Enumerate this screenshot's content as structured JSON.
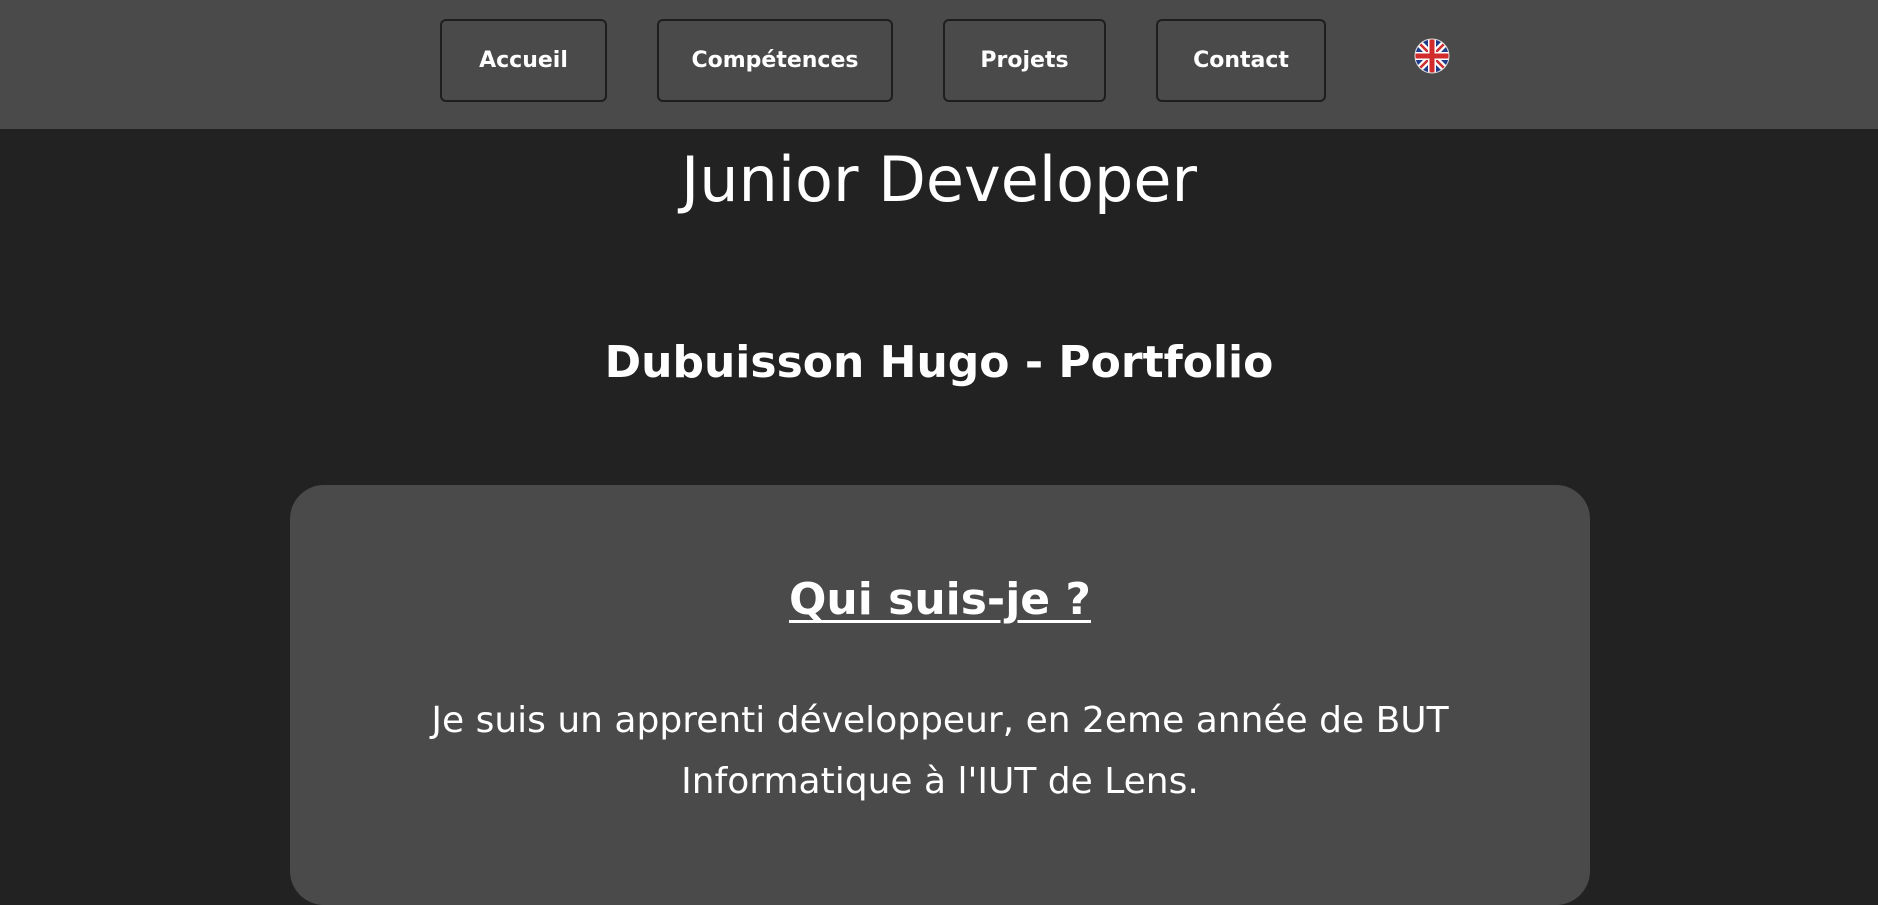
{
  "nav": {
    "items": [
      {
        "label": "Accueil"
      },
      {
        "label": "Compétences"
      },
      {
        "label": "Projets"
      },
      {
        "label": "Contact"
      }
    ],
    "language_icon": "uk-flag-icon"
  },
  "hero": {
    "title": "Junior Developer",
    "subtitle": "Dubuisson Hugo - Portfolio"
  },
  "about": {
    "heading": "Qui suis-je ?",
    "text": "Je suis un apprenti développeur, en 2eme année de BUT Informatique à l'IUT de Lens."
  },
  "colors": {
    "background": "#222222",
    "nav_background": "#4a4a4a",
    "card_background": "#4a4a4a",
    "text": "#ffffff"
  }
}
